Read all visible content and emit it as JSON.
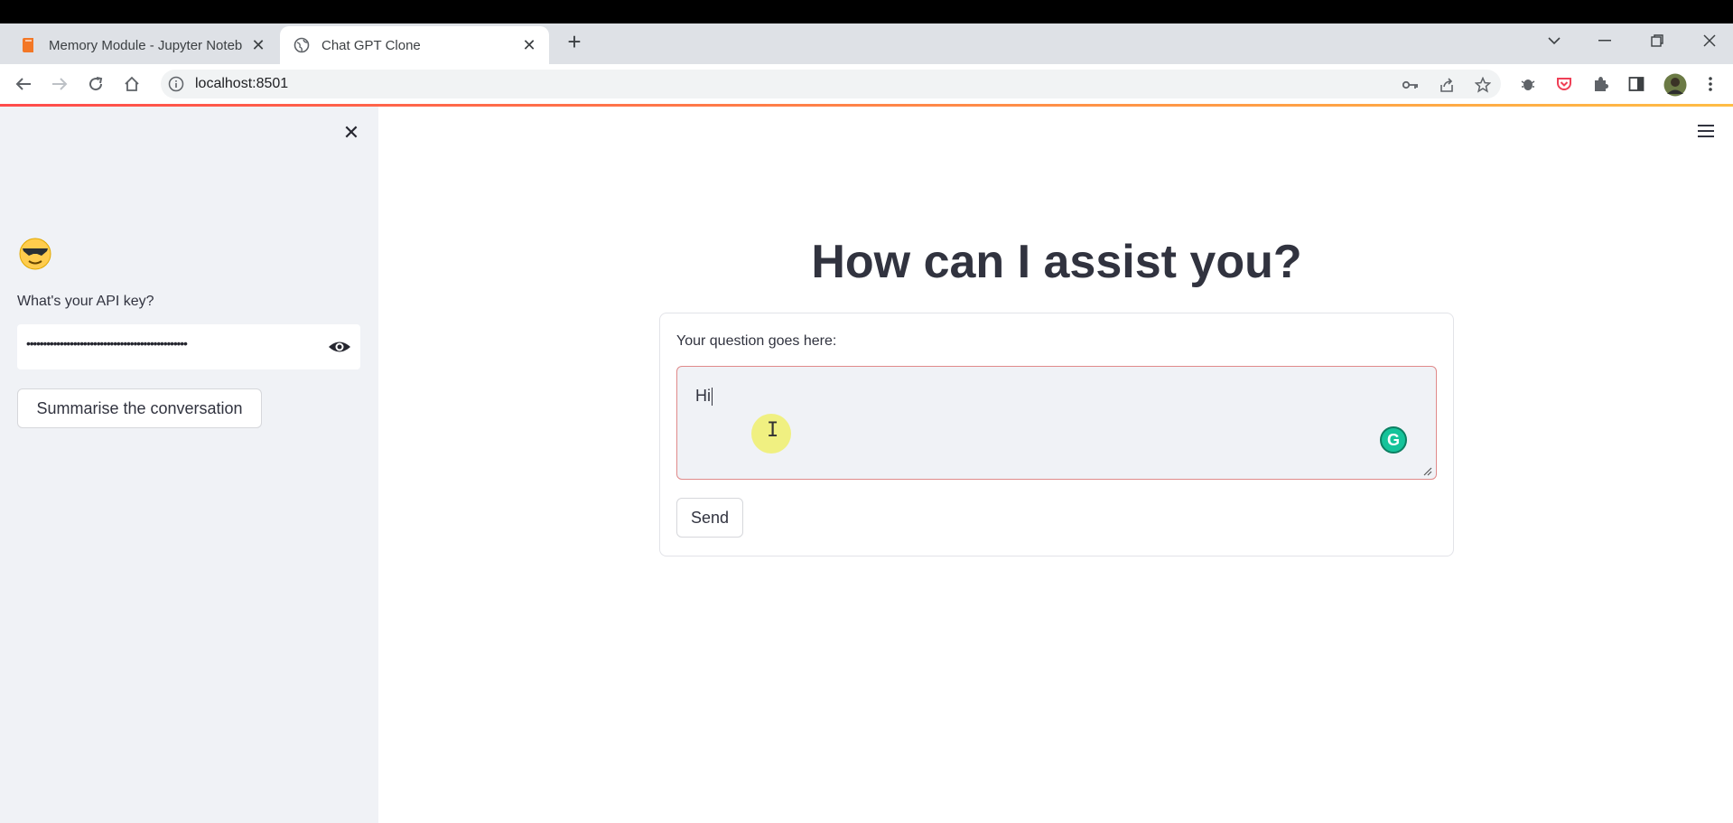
{
  "browser": {
    "tabs": [
      {
        "title": "Memory Module - Jupyter Noteb",
        "active": false,
        "icon": "jupyter-book-icon"
      },
      {
        "title": "Chat GPT Clone",
        "active": true,
        "icon": "globe-icon"
      }
    ],
    "url": "localhost:8501"
  },
  "sidebar": {
    "emoji": "😎",
    "api_label": "What's your API key?",
    "api_value": "••••••••••••••••••••••••••••••••••••••••••••••••",
    "summarise_button": "Summarise the conversation"
  },
  "main": {
    "title": "How can I assist you?",
    "question_label": "Your question goes here:",
    "question_value": "Hi",
    "send_button": "Send"
  },
  "colors": {
    "accent_gradient_start": "#ff4b4b",
    "accent_gradient_end": "#ffbd45",
    "sidebar_bg": "#f0f2f6",
    "grammarly_green": "#15c39a"
  }
}
